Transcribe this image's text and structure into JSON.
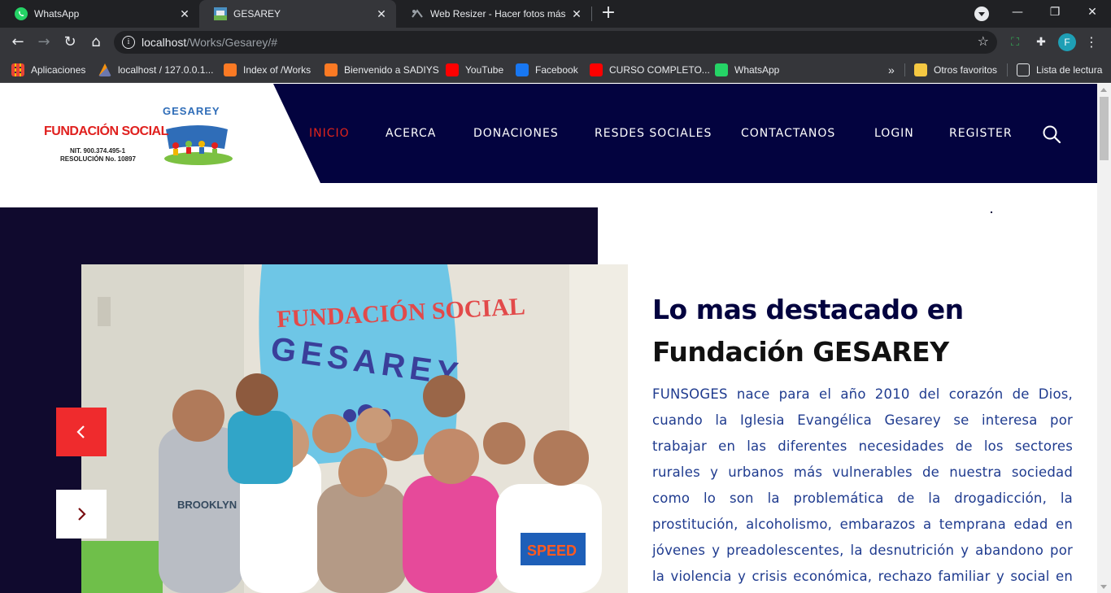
{
  "browser": {
    "tabs": [
      {
        "title": "WhatsApp",
        "icon": "whatsapp-icon"
      },
      {
        "title": "GESAREY",
        "icon": "gesarey-favicon"
      },
      {
        "title": "Web Resizer - Hacer fotos más rá",
        "icon": "resizer-icon"
      }
    ],
    "url_host": "localhost",
    "url_path": "/Works/Gesarey/#",
    "profile_initial": "F",
    "bookmarks": [
      {
        "label": "Aplicaciones"
      },
      {
        "label": "localhost / 127.0.0.1..."
      },
      {
        "label": "Index of /Works"
      },
      {
        "label": "Bienvenido a SADIYS"
      },
      {
        "label": "YouTube"
      },
      {
        "label": "Facebook"
      },
      {
        "label": "CURSO COMPLETO..."
      },
      {
        "label": "WhatsApp"
      }
    ],
    "bookmarks_overflow": "»",
    "other_favorites": "Otros favoritos",
    "reading_list": "Lista de lectura"
  },
  "header": {
    "logo_text": "FUNDACIÓN SOCIAL",
    "logo_brand": "GESAREY",
    "logo_nit": "NIT. 900.374.495-1",
    "logo_res": "RESOLUCIÓN No. 10897",
    "nav": [
      {
        "label": "INICIO",
        "active": true
      },
      {
        "label": "ACERCA"
      },
      {
        "label": "DONACIONES"
      },
      {
        "label": "RESDES SOCIALES"
      },
      {
        "label": "CONTACTANOS"
      },
      {
        "label": "LOGIN"
      },
      {
        "label": "REGISTER"
      }
    ]
  },
  "hero": {
    "banner_line1": "FUNDACIÓN SOCIAL",
    "banner_line2": "GESAREY",
    "shirt_text1": "BROOKLYN STATE",
    "shirt_text2": "SPEED"
  },
  "content": {
    "title_line1": "Lo mas destacado en",
    "title_line2": "Fundación GESAREY",
    "paragraph": "FUNSOGES nace para el año 2010 del corazón de Dios, cuando la Iglesia Evangélica Gesarey se interesa por trabajar en las diferentes necesidades de los sectores rurales y urbanos más vulnerables de nuestra sociedad como lo son la problemática de la drogadicción, la prostitución, alcoholismo, embarazos a temprana edad en jóvenes y preadolescentes, la desnutrición y abandono por la violencia y crisis económica, rechazo familiar y social en la"
  },
  "colors": {
    "nav_bg": "#03033f",
    "accent_red": "#ef2b2d",
    "slider_bg": "#100a2e",
    "title_blue": "#03033f",
    "text_blue": "#1f3b8f"
  }
}
